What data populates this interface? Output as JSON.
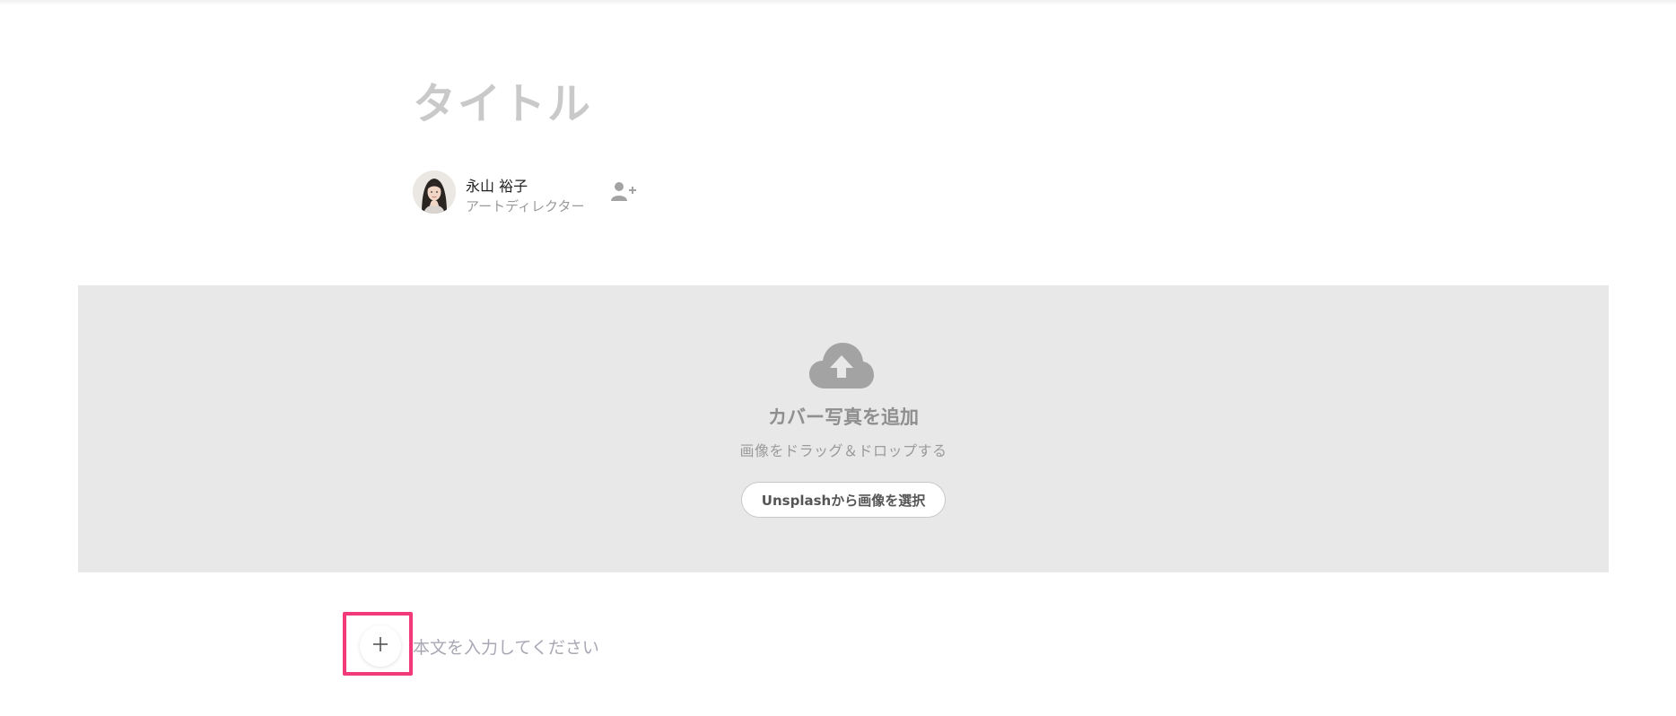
{
  "editor": {
    "title_placeholder": "タイトル",
    "body_placeholder": "本文を入力してください"
  },
  "author": {
    "name": "永山 裕子",
    "role": "アートディレクター",
    "add_author_icon": "user-plus-icon"
  },
  "cover": {
    "upload_icon": "cloud-upload-icon",
    "title": "カバー写真を追加",
    "subtitle": "画像をドラッグ＆ドロップする",
    "unsplash_button_label": "Unsplashから画像を選択"
  },
  "block_toolbar": {
    "add_button_icon": "plus-icon",
    "highlight_color": "#f23a7a"
  },
  "colors": {
    "cover_bg": "#e8e8e8",
    "title_placeholder": "#c9c9c9",
    "icon_gray": "#a3a3a3"
  }
}
